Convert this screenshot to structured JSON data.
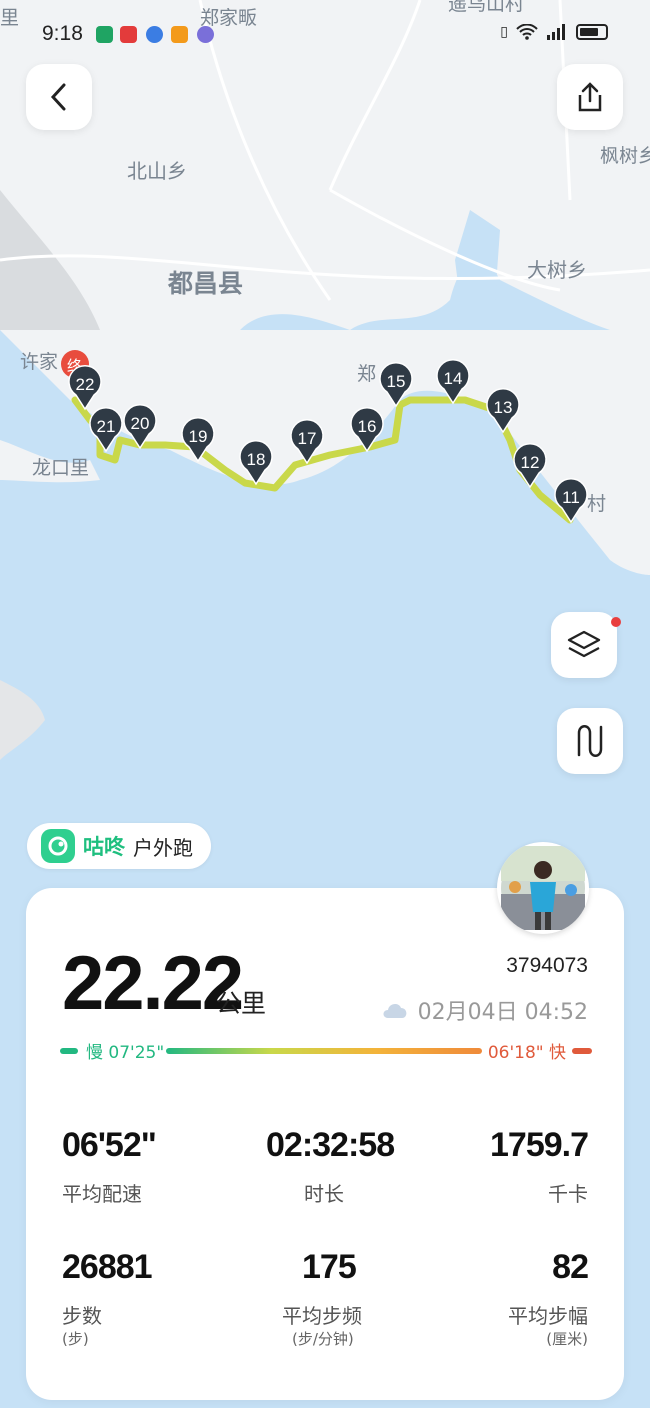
{
  "status_bar": {
    "time": "9:18"
  },
  "map": {
    "place_labels": [
      "郑家畈",
      "遥乌山村",
      "北山乡",
      "枫树乡",
      "都昌县",
      "大树乡",
      "许家",
      "龙口里",
      "郑",
      "村",
      "里"
    ],
    "end_marker": "终",
    "km_markers": [
      "22",
      "21",
      "20",
      "19",
      "18",
      "17",
      "16",
      "15",
      "14",
      "13",
      "12",
      "11"
    ]
  },
  "source": {
    "brand": "咕咚",
    "activity_type": "户外跑"
  },
  "summary": {
    "distance": "22.22",
    "distance_unit": "公里",
    "record_id": "3794073",
    "date": "02月04日 04:52",
    "pace_slow": "慢 07'25\"",
    "pace_fast": "06'18\" 快"
  },
  "stats": [
    {
      "value": "06'52\"",
      "label": "平均配速",
      "unit": ""
    },
    {
      "value": "02:32:58",
      "label": "时长",
      "unit": ""
    },
    {
      "value": "1759.7",
      "label": "千卡",
      "unit": ""
    },
    {
      "value": "26881",
      "label": "步数",
      "unit": "(步)"
    },
    {
      "value": "175",
      "label": "平均步频",
      "unit": "(步/分钟)"
    },
    {
      "value": "82",
      "label": "平均步幅",
      "unit": "(厘米)"
    }
  ],
  "colors": {
    "accent": "#1fbf7f",
    "route": "#c9d84a",
    "marker": "#2f3a45",
    "water": "#c6e1f6",
    "land": "#f1f3f5"
  }
}
